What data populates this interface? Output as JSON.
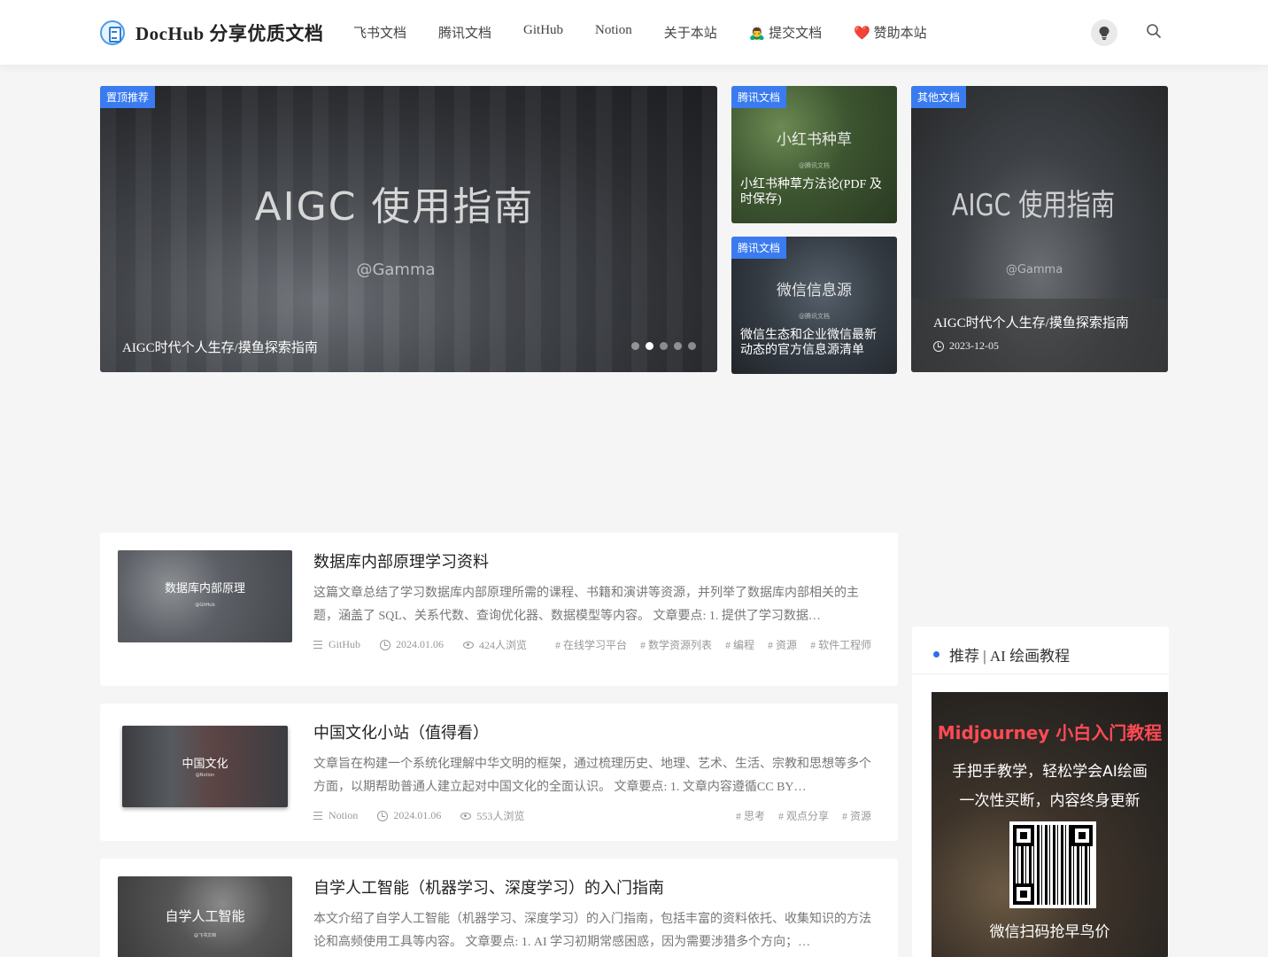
{
  "header": {
    "site_name": "DocHub 分享优质文档",
    "nav": [
      "飞书文档",
      "腾讯文档",
      "GitHub",
      "Notion",
      "关于本站",
      "🙇‍♂️ 提交文档",
      "❤️ 赞助本站"
    ],
    "theme_icon": "lightbulb-icon",
    "search_icon": "search-icon"
  },
  "hero": {
    "main": {
      "badge": "置顶推荐",
      "image_title": "AIGC 使用指南",
      "image_subtitle": "@Gamma",
      "caption": "AIGC时代个人生存/摸鱼探索指南",
      "slide_count": 5,
      "active_slide": 2
    },
    "side1": {
      "badge": "腾讯文档",
      "image_title": "小红书种草",
      "image_subtitle": "@腾讯文档",
      "caption": "小红书种草方法论(PDF 及时保存)"
    },
    "side2": {
      "badge": "腾讯文档",
      "image_title": "微信信息源",
      "image_subtitle": "@腾讯文档",
      "caption": "微信生态和企业微信最新动态的官方信息源清单"
    },
    "right": {
      "badge": "其他文档",
      "image_title": "AIGC 使用指南",
      "image_subtitle": "@Gamma",
      "caption": "AIGC时代个人生存/摸鱼探索指南",
      "date": "2023-12-05"
    }
  },
  "articles": [
    {
      "thumb_title": "数据库内部原理",
      "thumb_subtitle": "@GitHub",
      "title": "数据库内部原理学习资料",
      "excerpt": "这篇文章总结了学习数据库内部原理所需的课程、书籍和演讲等资源，并列举了数据库内部相关的主题，涵盖了 SQL、关系代数、查询优化器、数据模型等内容。 文章要点: 1. 提供了学习数据…",
      "category": "GitHub",
      "date": "2024.01.06",
      "views": "424人浏览",
      "tags": [
        "# 在线学习平台",
        "# 数学资源列表",
        "# 编程",
        "# 资源",
        "# 软件工程师"
      ]
    },
    {
      "thumb_title": "中国文化",
      "thumb_subtitle": "@Notion",
      "title": "中国文化小站（值得看）",
      "excerpt": "文章旨在构建一个系统化理解中华文明的框架，通过梳理历史、地理、艺术、生活、宗教和思想等多个方面，以期帮助普通人建立起对中国文化的全面认识。 文章要点: 1. 文章内容遵循CC BY…",
      "category": "Notion",
      "date": "2024.01.06",
      "views": "553人浏览",
      "tags": [
        "# 思考",
        "# 观点分享",
        "# 资源"
      ]
    },
    {
      "thumb_title": "自学人工智能",
      "thumb_subtitle": "@飞书文档",
      "title": "自学人工智能（机器学习、深度学习）的入门指南",
      "excerpt": "本文介绍了自学人工智能（机器学习、深度学习）的入门指南，包括丰富的资料依托、收集知识的方法论和高频使用工具等内容。 文章要点: 1. AI 学习初期常感困惑，因为需要涉猎多个方向；…"
    }
  ],
  "sidebar": {
    "title": "推荐 | AI 绘画教程",
    "ad_line1": "Midjourney 小白入门教程",
    "ad_line2": "手把手教学，轻松学会AI绘画",
    "ad_line3": "一次性买断，内容终身更新",
    "ad_line4": "微信扫码抢早鸟价"
  },
  "colors": {
    "accent": "#3a7bf0",
    "ad_red": "#ff4a55"
  }
}
